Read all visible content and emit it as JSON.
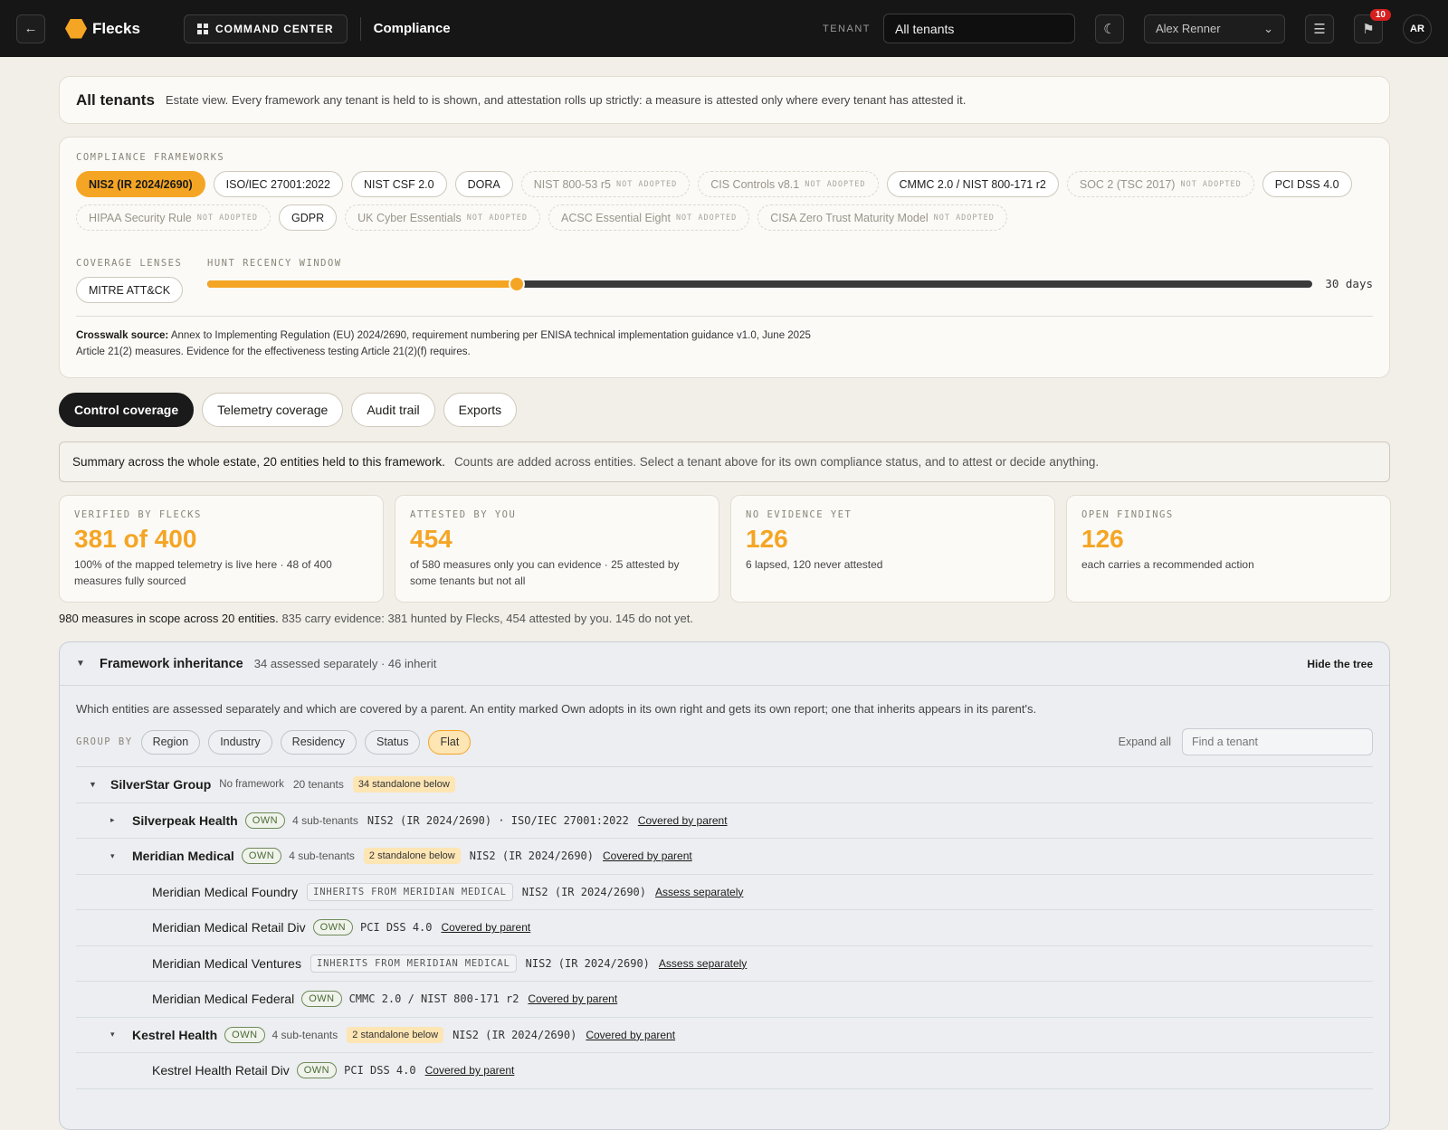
{
  "topbar": {
    "back_icon": "arrow-left-icon",
    "brand": "Flecks",
    "command_center": "COMMAND CENTER",
    "page": "Compliance",
    "tenant_label": "TENANT",
    "tenant_value": "All tenants",
    "theme_icon": "moon-icon",
    "user": "Alex Renner",
    "notifications": "10",
    "avatar": "AR"
  },
  "banner": {
    "title": "All tenants",
    "text": "Estate view. Every framework any tenant is held to is shown, and attestation rolls up strictly: a measure is attested only where every tenant has attested it."
  },
  "frameworks": {
    "label": "COMPLIANCE FRAMEWORKS",
    "not_adopted": "NOT ADOPTED",
    "items": [
      {
        "name": "NIS2 (IR 2024/2690)",
        "state": "active"
      },
      {
        "name": "ISO/IEC 27001:2022",
        "state": "adopted"
      },
      {
        "name": "NIST CSF 2.0",
        "state": "adopted"
      },
      {
        "name": "DORA",
        "state": "adopted"
      },
      {
        "name": "NIST 800-53 r5",
        "state": "na"
      },
      {
        "name": "CIS Controls v8.1",
        "state": "na"
      },
      {
        "name": "CMMC 2.0 / NIST 800-171 r2",
        "state": "adopted"
      },
      {
        "name": "SOC 2 (TSC 2017)",
        "state": "na"
      },
      {
        "name": "PCI DSS 4.0",
        "state": "adopted"
      },
      {
        "name": "HIPAA Security Rule",
        "state": "na"
      },
      {
        "name": "GDPR",
        "state": "adopted"
      },
      {
        "name": "UK Cyber Essentials",
        "state": "na"
      },
      {
        "name": "ACSC Essential Eight",
        "state": "na"
      },
      {
        "name": "CISA Zero Trust Maturity Model",
        "state": "na"
      }
    ],
    "lenses_label": "COVERAGE LENSES",
    "lens": "MITRE ATT&CK",
    "hunt_label": "HUNT RECENCY WINDOW",
    "hunt_fraction": 0.28,
    "hunt_value": "30 days",
    "source_label": "Crosswalk source:",
    "source_text": "Annex to Implementing Regulation (EU) 2024/2690, requirement numbering per ENISA technical implementation guidance v1.0, June 2025",
    "source_line2": "Article 21(2) measures. Evidence for the effectiveness testing Article 21(2)(f) requires."
  },
  "tabs": [
    "Control coverage",
    "Telemetry coverage",
    "Audit trail",
    "Exports"
  ],
  "summary": {
    "main": "Summary across the whole estate, 20 entities held to this framework.",
    "note": "Counts are added across entities. Select a tenant above for its own compliance status, and to attest or decide anything."
  },
  "stats": [
    {
      "label": "VERIFIED BY FLECKS",
      "value": "381 of 400",
      "sub": "100% of the mapped telemetry is live here · 48 of 400 measures fully sourced"
    },
    {
      "label": "ATTESTED BY YOU",
      "value": "454",
      "sub": "of 580 measures only you can evidence · 25 attested by some tenants but not all"
    },
    {
      "label": "NO EVIDENCE YET",
      "value": "126",
      "sub": "6 lapsed, 120 never attested"
    },
    {
      "label": "OPEN FINDINGS",
      "value": "126",
      "sub": "each carries a recommended action"
    }
  ],
  "measures": {
    "main": "980 measures in scope across 20 entities.",
    "rest": "835 carry evidence: 381 hunted by Flecks, 454 attested by you. 145 do not yet."
  },
  "inheritance": {
    "title": "Framework inheritance",
    "meta": "34 assessed separately · 46 inherit",
    "hide": "Hide the tree",
    "desc": "Which entities are assessed separately and which are covered by a parent. An entity marked Own adopts in its own right and gets its own report; one that inherits appears in its parent's.",
    "group_label": "GROUP BY",
    "groups": [
      "Region",
      "Industry",
      "Residency",
      "Status",
      "Flat"
    ],
    "expand_all": "Expand all",
    "find_placeholder": "Find a tenant",
    "root": {
      "name": "SilverStar Group",
      "framework": "No framework",
      "count": "20 tenants",
      "standalone": "34 standalone below"
    },
    "own_label": "OWN",
    "rows": [
      {
        "name": "Silverpeak Health",
        "caret": "▸",
        "own": true,
        "subs": "4 sub-tenants",
        "fw": "NIS2 (IR 2024/2690)  ·  ISO/IEC 27001:2022",
        "action": "Covered by parent"
      },
      {
        "name": "Meridian Medical",
        "caret": "▾",
        "own": true,
        "subs": "4 sub-tenants",
        "standalone": "2 standalone below",
        "fw": "NIS2 (IR 2024/2690)",
        "action": "Covered by parent"
      },
      {
        "name": "Meridian Medical Foundry",
        "child": true,
        "inherits": "INHERITS FROM MERIDIAN MEDICAL",
        "fw": "NIS2 (IR 2024/2690)",
        "action": "Assess separately"
      },
      {
        "name": "Meridian Medical Retail Div",
        "child": true,
        "own": true,
        "fw": "PCI DSS 4.0",
        "action": "Covered by parent"
      },
      {
        "name": "Meridian Medical Ventures",
        "child": true,
        "inherits": "INHERITS FROM MERIDIAN MEDICAL",
        "fw": "NIS2 (IR 2024/2690)",
        "action": "Assess separately"
      },
      {
        "name": "Meridian Medical Federal",
        "child": true,
        "own": true,
        "fw": "CMMC 2.0 / NIST 800-171 r2",
        "action": "Covered by parent"
      },
      {
        "name": "Kestrel Health",
        "caret": "▾",
        "own": true,
        "subs": "4 sub-tenants",
        "standalone": "2 standalone below",
        "fw": "NIS2 (IR 2024/2690)",
        "action": "Covered by parent"
      },
      {
        "name": "Kestrel Health Retail Div",
        "child": true,
        "own": true,
        "fw": "PCI DSS 4.0",
        "action": "Covered by parent"
      }
    ]
  }
}
